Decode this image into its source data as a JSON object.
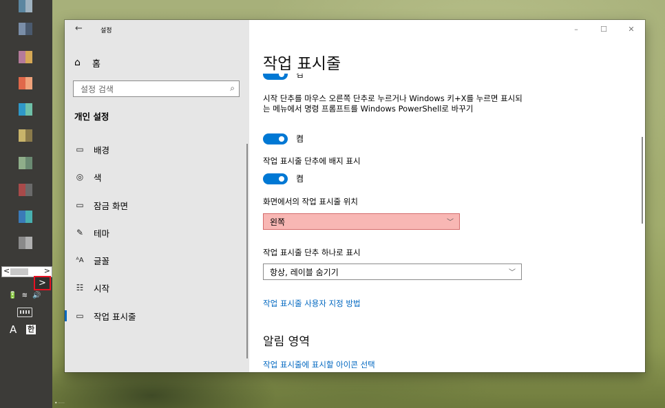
{
  "taskbar": {
    "app_icons": [
      {
        "icon": "pixelated-app-icon",
        "colors": [
          "#5b86a0",
          "#9fb2c0"
        ]
      },
      {
        "icon": "pixelated-app-icon",
        "colors": [
          "#7a8ea8",
          "#4a5a6e"
        ]
      },
      {
        "icon": "pixelated-app-icon",
        "colors": [
          "#b47a9a",
          "#d6a855"
        ]
      },
      {
        "icon": "pixelated-app-icon",
        "colors": [
          "#e0684a",
          "#f0a27a"
        ]
      },
      {
        "icon": "pixelated-app-icon",
        "colors": [
          "#2f98c8",
          "#6fc0a8"
        ]
      },
      {
        "icon": "pixelated-app-icon",
        "colors": [
          "#c8b46a",
          "#8a7a4a"
        ]
      },
      {
        "icon": "pixelated-app-icon",
        "colors": [
          "#8fae8a",
          "#6a8a72"
        ]
      },
      {
        "icon": "pixelated-app-icon",
        "colors": [
          "#a84a4a",
          "#6a6a6a"
        ]
      },
      {
        "icon": "pixelated-app-icon",
        "colors": [
          "#3a7ab8",
          "#48b0b0"
        ]
      },
      {
        "icon": "pixelated-app-icon",
        "colors": [
          "#8a8a8a",
          "#b0b0b0"
        ]
      }
    ],
    "scroll_left": "<",
    "scroll_right": ">",
    "overflow_chevron": ">",
    "tray_icons": "🔋 ≋ 🔊",
    "ime_lang": "A",
    "ime_mode": "한",
    "footer_text": "⦁ ⋯⋯"
  },
  "window": {
    "app_title": "설정",
    "back_icon": "←",
    "caption": {
      "minimize": "–",
      "maximize": "☐",
      "close": "✕"
    },
    "sidebar": {
      "home_label": "홈",
      "search_placeholder": "설정 검색",
      "section_label": "개인 설정",
      "items": [
        {
          "label": "배경",
          "icon": "background-image-icon",
          "glyph": "▭"
        },
        {
          "label": "색",
          "icon": "palette-icon",
          "glyph": "◎"
        },
        {
          "label": "잠금 화면",
          "icon": "lock-screen-icon",
          "glyph": "▭"
        },
        {
          "label": "테마",
          "icon": "theme-brush-icon",
          "glyph": "✎"
        },
        {
          "label": "글꼴",
          "icon": "font-icon",
          "glyph": "ᴬA"
        },
        {
          "label": "시작",
          "icon": "start-menu-icon",
          "glyph": "☷"
        },
        {
          "label": "작업 표시줄",
          "icon": "taskbar-icon",
          "glyph": "▭",
          "active": true
        }
      ]
    },
    "main": {
      "page_title": "작업 표시줄",
      "top_toggle_state": "켬",
      "setting_powershell": "시작 단추를 마우스 오른쪽 단추로 누르거나 Windows 키+X를 누르면 표시되는 메뉴에서 명령 프롬프트를 Windows PowerShell로 바꾸기",
      "toggle_powershell_state": "켬",
      "setting_badges": "작업 표시줄 단추에 배지 표시",
      "toggle_badges_state": "켬",
      "setting_location": "화면에서의 작업 표시줄 위치",
      "location_value": "왼쪽",
      "setting_combine": "작업 표시줄 단추 하나로 표시",
      "combine_value": "항상, 레이블 숨기기",
      "link_customize": "작업 표시줄 사용자 지정 방법",
      "section_notification": "알림 영역",
      "link_select_icons": "작업 표시줄에 표시할 아이콘 선택"
    }
  }
}
